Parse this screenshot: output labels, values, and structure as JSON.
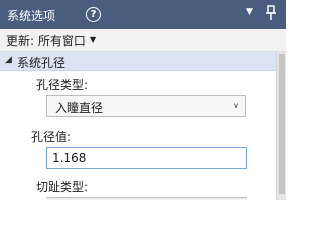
{
  "panel": {
    "title": "系统选项",
    "help_icon": "?",
    "toolbar": {
      "update_label": "更新: 所有窗口",
      "dropdown_icon": "chevron-down-icon"
    },
    "section": {
      "label": "系统孔径"
    },
    "fields": {
      "aperture_type": {
        "label": "孔径类型:",
        "selected": "入瞳直径"
      },
      "aperture_value": {
        "label": "孔径值:",
        "value": "1.168"
      },
      "apodization_type": {
        "label": "切趾类型:"
      }
    },
    "colors": {
      "titlebar": "#4a5d7e",
      "section_header": "#dbe4f2",
      "input_focus_border": "#7aa7d8"
    }
  }
}
